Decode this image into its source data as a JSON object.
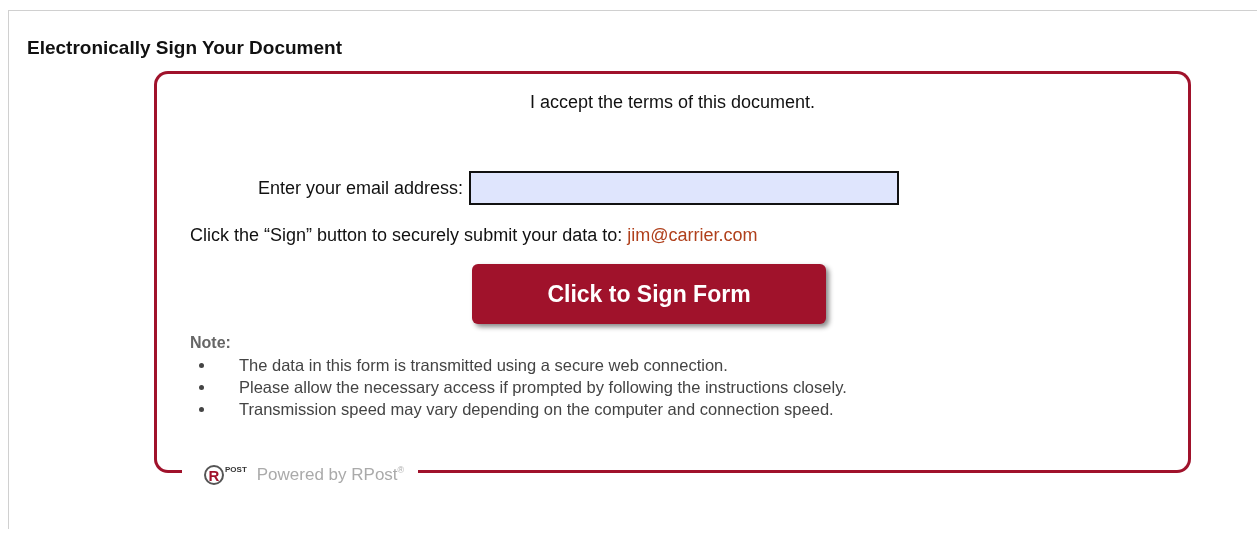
{
  "title": "Electronically Sign Your Document",
  "accept_text": "I accept the terms of this document.",
  "email_field": {
    "label": "Enter your email address:"
  },
  "submit_text": "Click the “Sign” button to securely submit your data to:",
  "recipient": "jim@carrier.com",
  "sign_button": "Click to Sign Form",
  "note": {
    "heading": "Note:",
    "items": [
      "The data in this form is transmitted using a secure web connection.",
      "Please allow the necessary access if prompted by following the instructions closely.",
      "Transmission speed may vary depending on the computer and connection speed."
    ]
  },
  "footer": {
    "logo_letter": "R",
    "logo_text": "POST",
    "text": "Powered by RPost",
    "mark": "®"
  }
}
